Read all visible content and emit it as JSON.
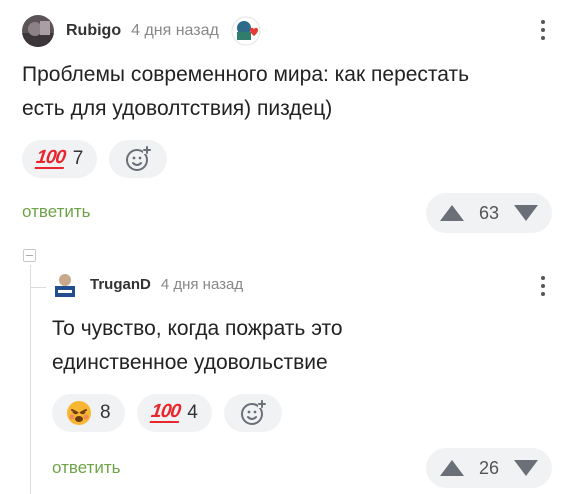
{
  "comments": [
    {
      "username": "Rubigo",
      "time": "4 дня назад",
      "text_lines": [
        "Проблемы современного мира: как перестать",
        "есть для удоволтствия) пиздец)"
      ],
      "reactions": [
        {
          "emoji": "100",
          "count": "7"
        }
      ],
      "reply_label": "ответить",
      "rating": "63"
    },
    {
      "username": "TruganD",
      "time": "4 дня назад",
      "text_lines": [
        "То чувство, когда пожрать это",
        "единственное удовольствие"
      ],
      "reactions": [
        {
          "emoji": "tired-face",
          "count": "8"
        },
        {
          "emoji": "100",
          "count": "4"
        }
      ],
      "reply_label": "ответить",
      "rating": "26"
    }
  ],
  "icons": {
    "more": "more-vertical-icon",
    "add_reaction": "add-reaction-icon",
    "upvote": "upvote-icon",
    "downvote": "downvote-icon"
  },
  "colors": {
    "accent_green": "#6ea347",
    "hundred_red": "#e8262c",
    "chip_bg": "#f1f2f4"
  }
}
